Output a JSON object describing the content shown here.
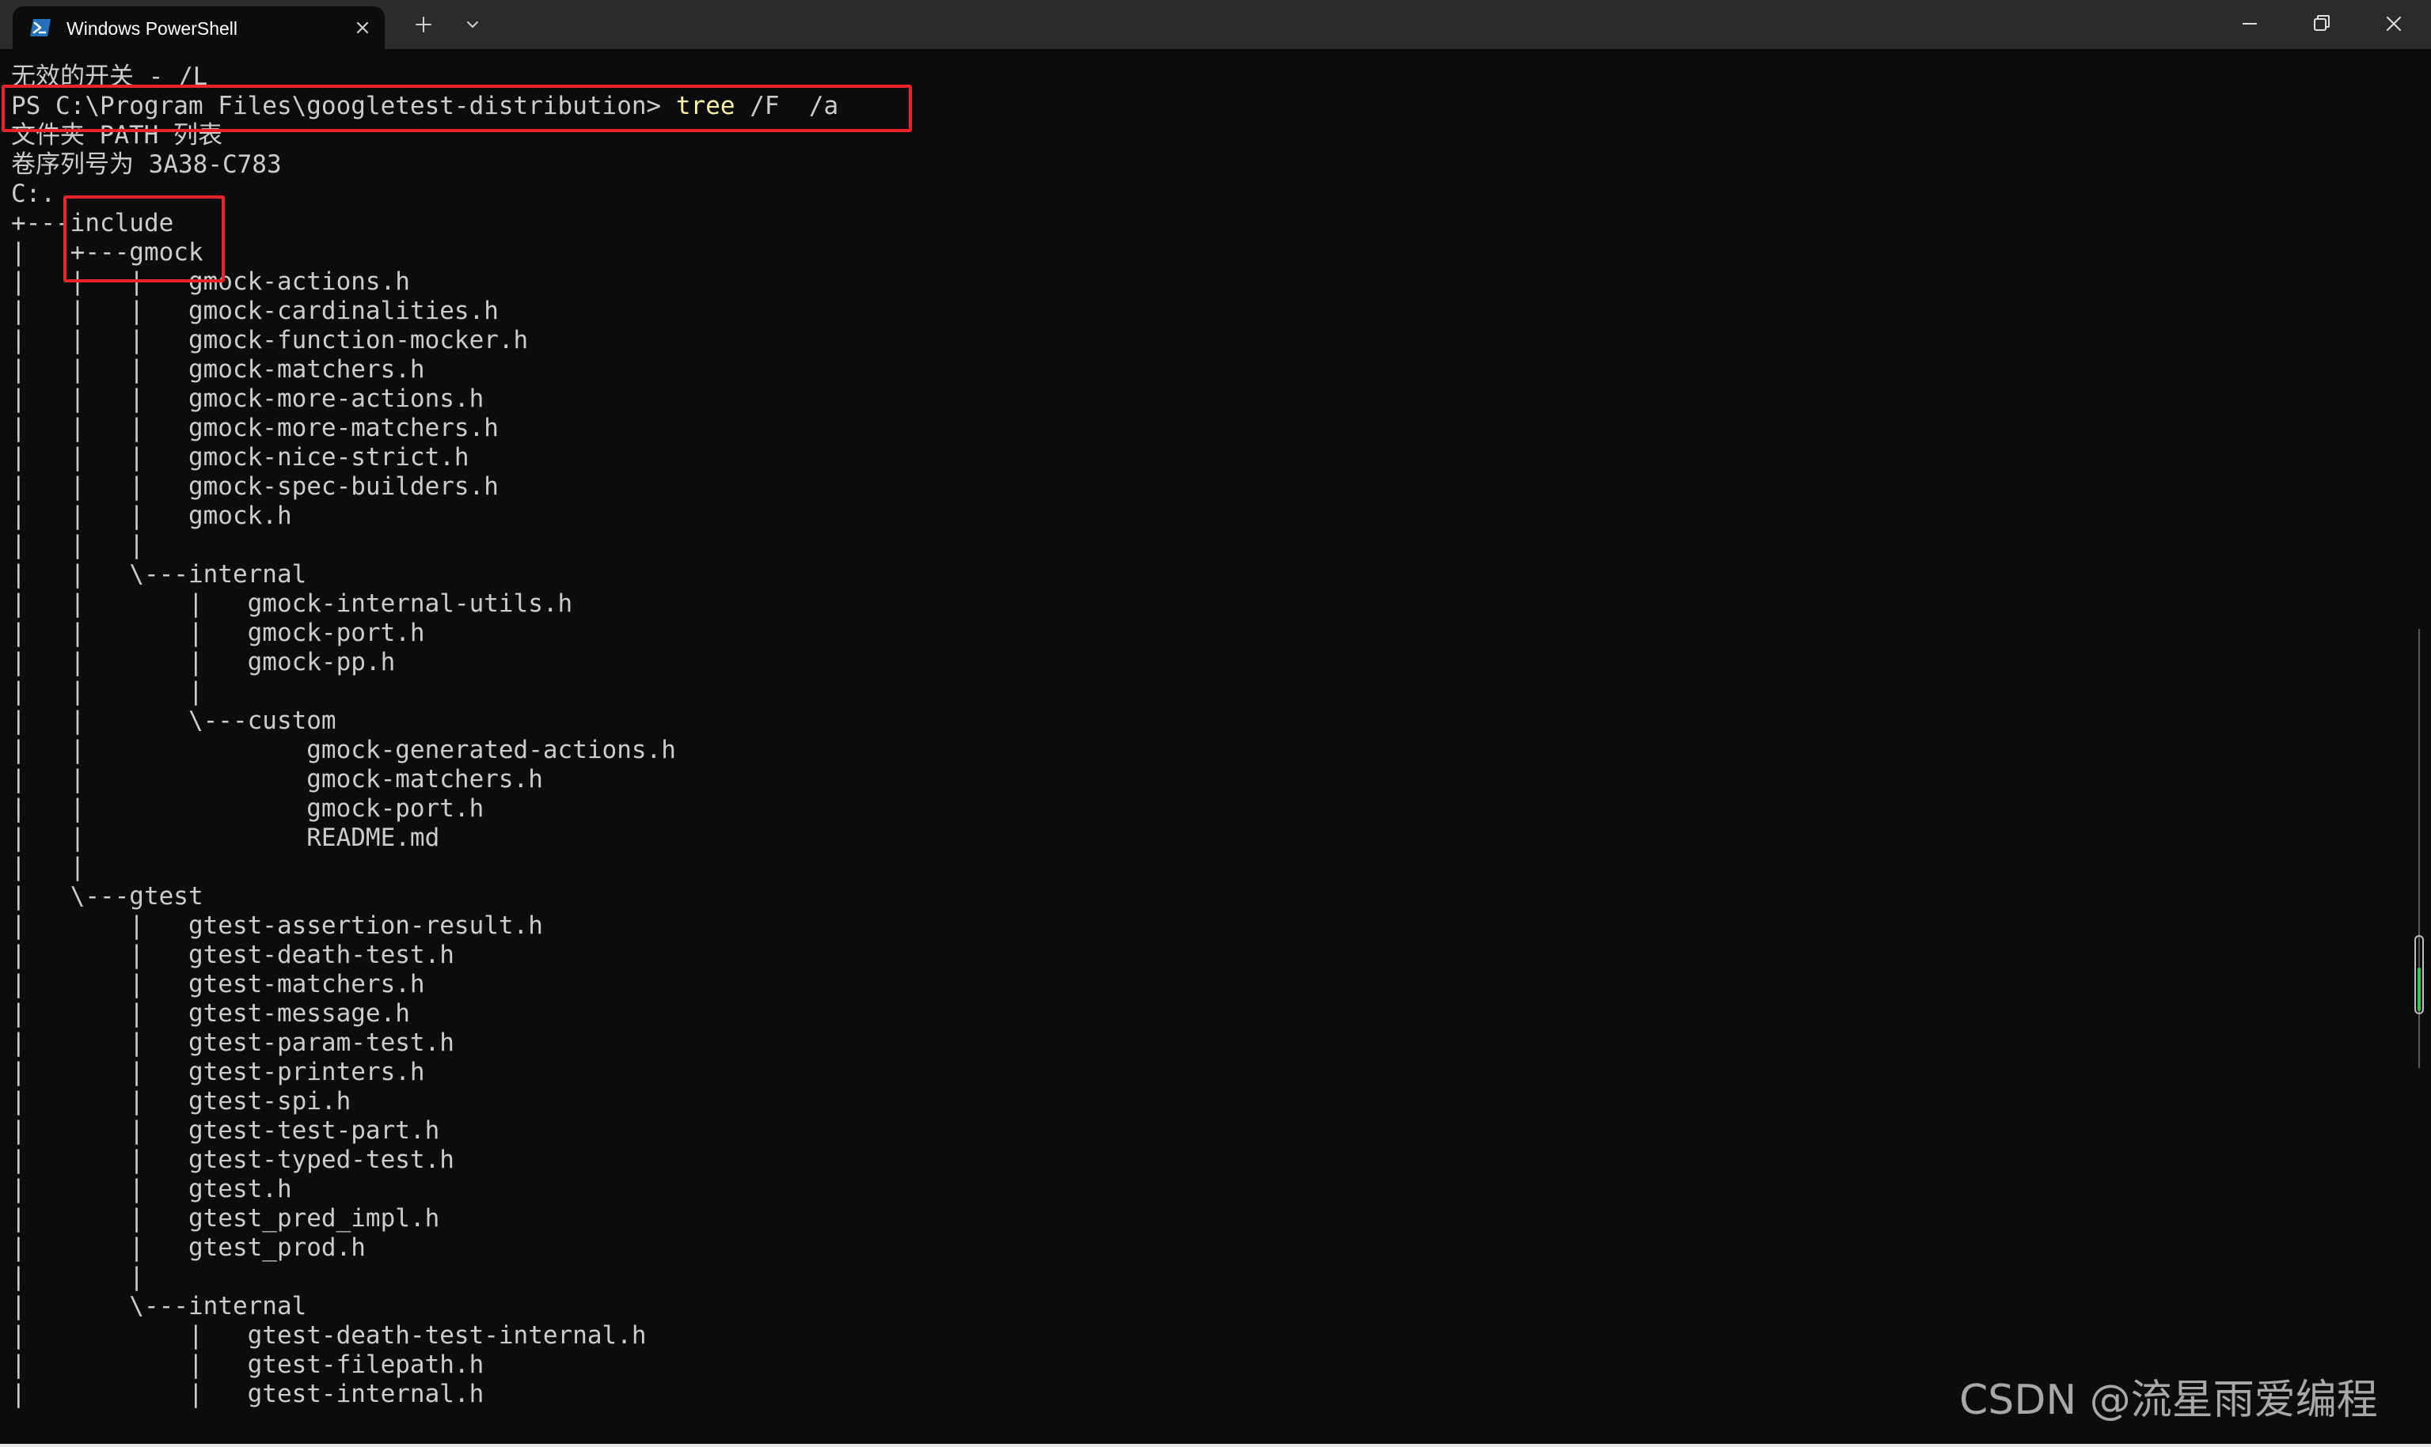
{
  "window": {
    "tab_title": "Windows PowerShell",
    "icons": {
      "tab": "powershell-icon",
      "close": "close-icon",
      "new_tab": "plus-icon",
      "dropdown": "chevron-down-icon",
      "minimize": "minimize-icon",
      "restore": "restore-icon",
      "window_close": "close-icon"
    }
  },
  "terminal": {
    "lines": [
      "无效的开关 - /L",
      "PS C:\\Program Files\\googletest-distribution> tree /F  /a",
      "文件夹 PATH 列表",
      "卷序列号为 3A38-C783",
      "C:.",
      "+---include",
      "|   +---gmock",
      "|   |   |   gmock-actions.h",
      "|   |   |   gmock-cardinalities.h",
      "|   |   |   gmock-function-mocker.h",
      "|   |   |   gmock-matchers.h",
      "|   |   |   gmock-more-actions.h",
      "|   |   |   gmock-more-matchers.h",
      "|   |   |   gmock-nice-strict.h",
      "|   |   |   gmock-spec-builders.h",
      "|   |   |   gmock.h",
      "|   |   |",
      "|   |   \\---internal",
      "|   |       |   gmock-internal-utils.h",
      "|   |       |   gmock-port.h",
      "|   |       |   gmock-pp.h",
      "|   |       |",
      "|   |       \\---custom",
      "|   |               gmock-generated-actions.h",
      "|   |               gmock-matchers.h",
      "|   |               gmock-port.h",
      "|   |               README.md",
      "|   |",
      "|   \\---gtest",
      "|       |   gtest-assertion-result.h",
      "|       |   gtest-death-test.h",
      "|       |   gtest-matchers.h",
      "|       |   gtest-message.h",
      "|       |   gtest-param-test.h",
      "|       |   gtest-printers.h",
      "|       |   gtest-spi.h",
      "|       |   gtest-test-part.h",
      "|       |   gtest-typed-test.h",
      "|       |   gtest.h",
      "|       |   gtest_pred_impl.h",
      "|       |   gtest_prod.h",
      "|       |",
      "|       \\---internal",
      "|           |   gtest-death-test-internal.h",
      "|           |   gtest-filepath.h",
      "|           |   gtest-internal.h"
    ],
    "prompt": "PS C:\\Program Files\\googletest-distribution>",
    "command": "tree",
    "command_args": "/F  /a"
  },
  "scrollbar": {
    "position_fraction": 0.85
  },
  "watermark": "CSDN @流星雨爱编程",
  "colors": {
    "background": "#0c0c0c",
    "text": "#cccccc",
    "command": "#f9f1a5",
    "highlight_box": "#e8232a",
    "scroll_thumb": "#2ecc40"
  }
}
